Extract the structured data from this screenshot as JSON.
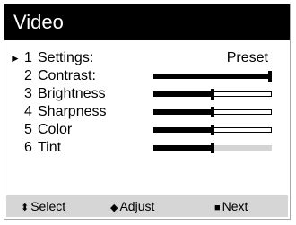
{
  "menu": {
    "title": "Video",
    "rows": [
      {
        "number": "1",
        "label": "Settings:",
        "value": "Preset",
        "selected": true
      },
      {
        "number": "2",
        "label": "Contrast:",
        "level": 1.0
      },
      {
        "number": "3",
        "label": "Brightness",
        "level": 0.5
      },
      {
        "number": "4",
        "label": "Sharpness",
        "level": 0.5
      },
      {
        "number": "5",
        "label": "Color",
        "level": 0.5
      },
      {
        "number": "6",
        "label": "Tint",
        "level": 0.5,
        "muted": true
      }
    ],
    "pointer_glyph": "►"
  },
  "footer": {
    "select": {
      "glyph": "⬍",
      "label": "Select"
    },
    "adjust": {
      "glyph": "◆",
      "label": "Adjust"
    },
    "next": {
      "glyph": "■",
      "label": "Next"
    }
  },
  "colors": {
    "title_bg": "#000000",
    "footer_bg": "#d6d6d6",
    "disabled_track": "#d4d4d4"
  }
}
